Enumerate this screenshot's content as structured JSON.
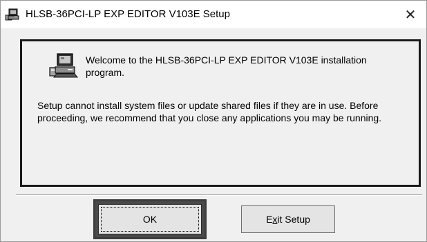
{
  "window": {
    "title": "HLSB-36PCI-LP EXP EDITOR V103E Setup",
    "close_symbol": "✕"
  },
  "icons": {
    "title_icon": "setup-computer-icon",
    "dialog_icon": "setup-computer-icon",
    "close_icon": "close-icon"
  },
  "message": {
    "welcome": "Welcome to the HLSB-36PCI-LP EXP EDITOR V103E installation program.",
    "warning": "Setup cannot install system files or update shared files if they are in use. Before proceeding, we recommend that you close any applications you may be running."
  },
  "buttons": {
    "ok_label": "OK",
    "exit_label_before": "E",
    "exit_label_accel": "x",
    "exit_label_after": "it Setup"
  },
  "colors": {
    "window_bg": "#f0f0f0",
    "titlebar_bg": "#ffffff",
    "panel_border": "#1a1a1a"
  }
}
